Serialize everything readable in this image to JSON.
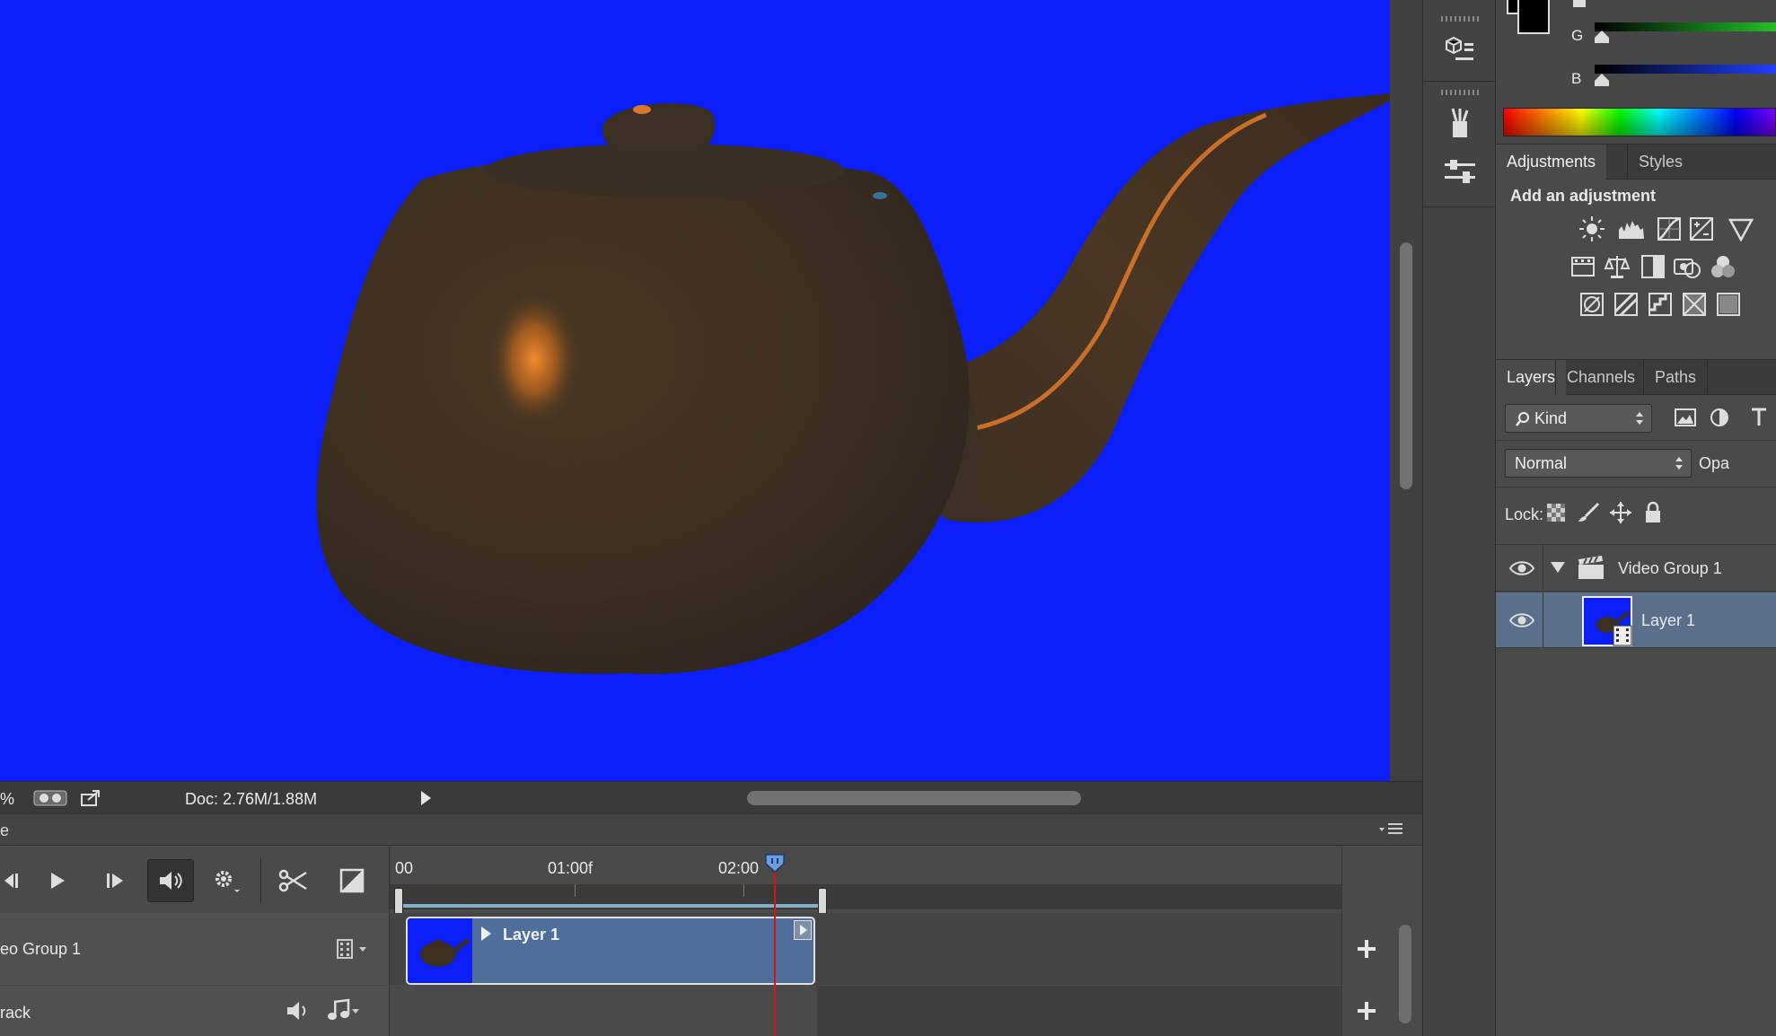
{
  "canvas": {
    "background": "#0a1ffa",
    "object": "teapot"
  },
  "statusbar": {
    "zoom_suffix": "%",
    "doc_info": "Doc: 2.76M/1.88M"
  },
  "timeline": {
    "tab_label": "e",
    "ruler": {
      "labels": [
        "00",
        "01:00f",
        "02:00"
      ]
    },
    "tracks": [
      {
        "name": "eo Group 1",
        "clip_label": "Layer 1"
      },
      {
        "name": "rack"
      }
    ]
  },
  "color_panel": {
    "channels": [
      "G",
      "B"
    ]
  },
  "adjustments": {
    "tabs": [
      "Adjustments",
      "Styles"
    ],
    "heading": "Add an adjustment"
  },
  "layers_panel": {
    "tabs": [
      "Layers",
      "Channels",
      "Paths"
    ],
    "filter_kind": "Kind",
    "blend_mode": "Normal",
    "opacity_label": "Opa",
    "lock_label": "Lock:",
    "layers": [
      {
        "name": "Video Group 1",
        "type": "video-group"
      },
      {
        "name": "Layer 1",
        "type": "video-layer",
        "selected": true
      }
    ]
  },
  "colors": {
    "accent": "#4f6f9a",
    "playhead": "#d01818",
    "selection": "#5c6f8a"
  }
}
